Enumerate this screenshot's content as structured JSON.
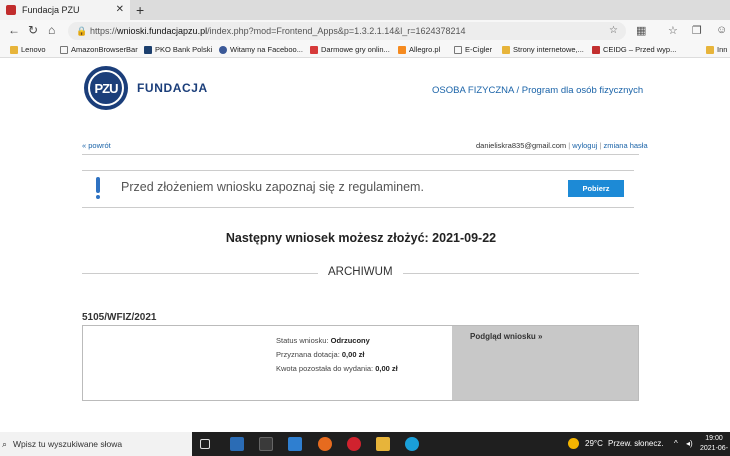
{
  "browser": {
    "tab_title": "Fundacja PZU",
    "url_host": "wnioski.fundacjapzu.pl",
    "url_path": "/index.php?mod=Frontend_Apps&p=1.3.2.1.14&l_r=1624378214",
    "url_scheme": "https://",
    "bookmarks": [
      "Lenovo",
      "AmazonBrowserBar",
      "PKO Bank Polski",
      "Witamy na Faceboo...",
      "Darmowe gry onlin...",
      "Allegro.pl",
      "E-Cigler",
      "Strony internetowe,...",
      "CEIDG – Przed wyp...",
      "Inn"
    ]
  },
  "site": {
    "logo_text": "PZU",
    "brand": "FUNDACJA",
    "nav_user_type": "OSOBA FIZYCZNA",
    "nav_separator": " / ",
    "nav_program": "Program dla osób fizycznych",
    "back_link": "« powrót",
    "account_email": "danieliskra835@gmail.com",
    "logout": "wyloguj",
    "change_password": "zmiana hasła",
    "notice_text": "Przed złożeniem wniosku zapoznaj się z regulaminem.",
    "download_button": "Pobierz",
    "next_application": "Następny wniosek możesz złożyć: 2021-09-22",
    "archive_title": "ARCHIWUM",
    "application": {
      "number": "5105/WFIZ/2021",
      "status_label": "Status wniosku:",
      "status_value": "Odrzucony",
      "grant_label": "Przyznana dotacja:",
      "grant_value": "0,00 zł",
      "remaining_label": "Kwota pozostała do wydania:",
      "remaining_value": "0,00 zł",
      "preview_link": "Podgląd wniosku »"
    }
  },
  "taskbar": {
    "search_placeholder": "Wpisz tu wyszukiwane słowa",
    "temperature": "29°C",
    "weather": "Przew. słonecz.",
    "time": "19:00",
    "date": "2021-06-"
  },
  "colors": {
    "brand_blue": "#1b3e7a",
    "link_blue": "#1a63a8",
    "button_blue": "#1d8ad6"
  }
}
